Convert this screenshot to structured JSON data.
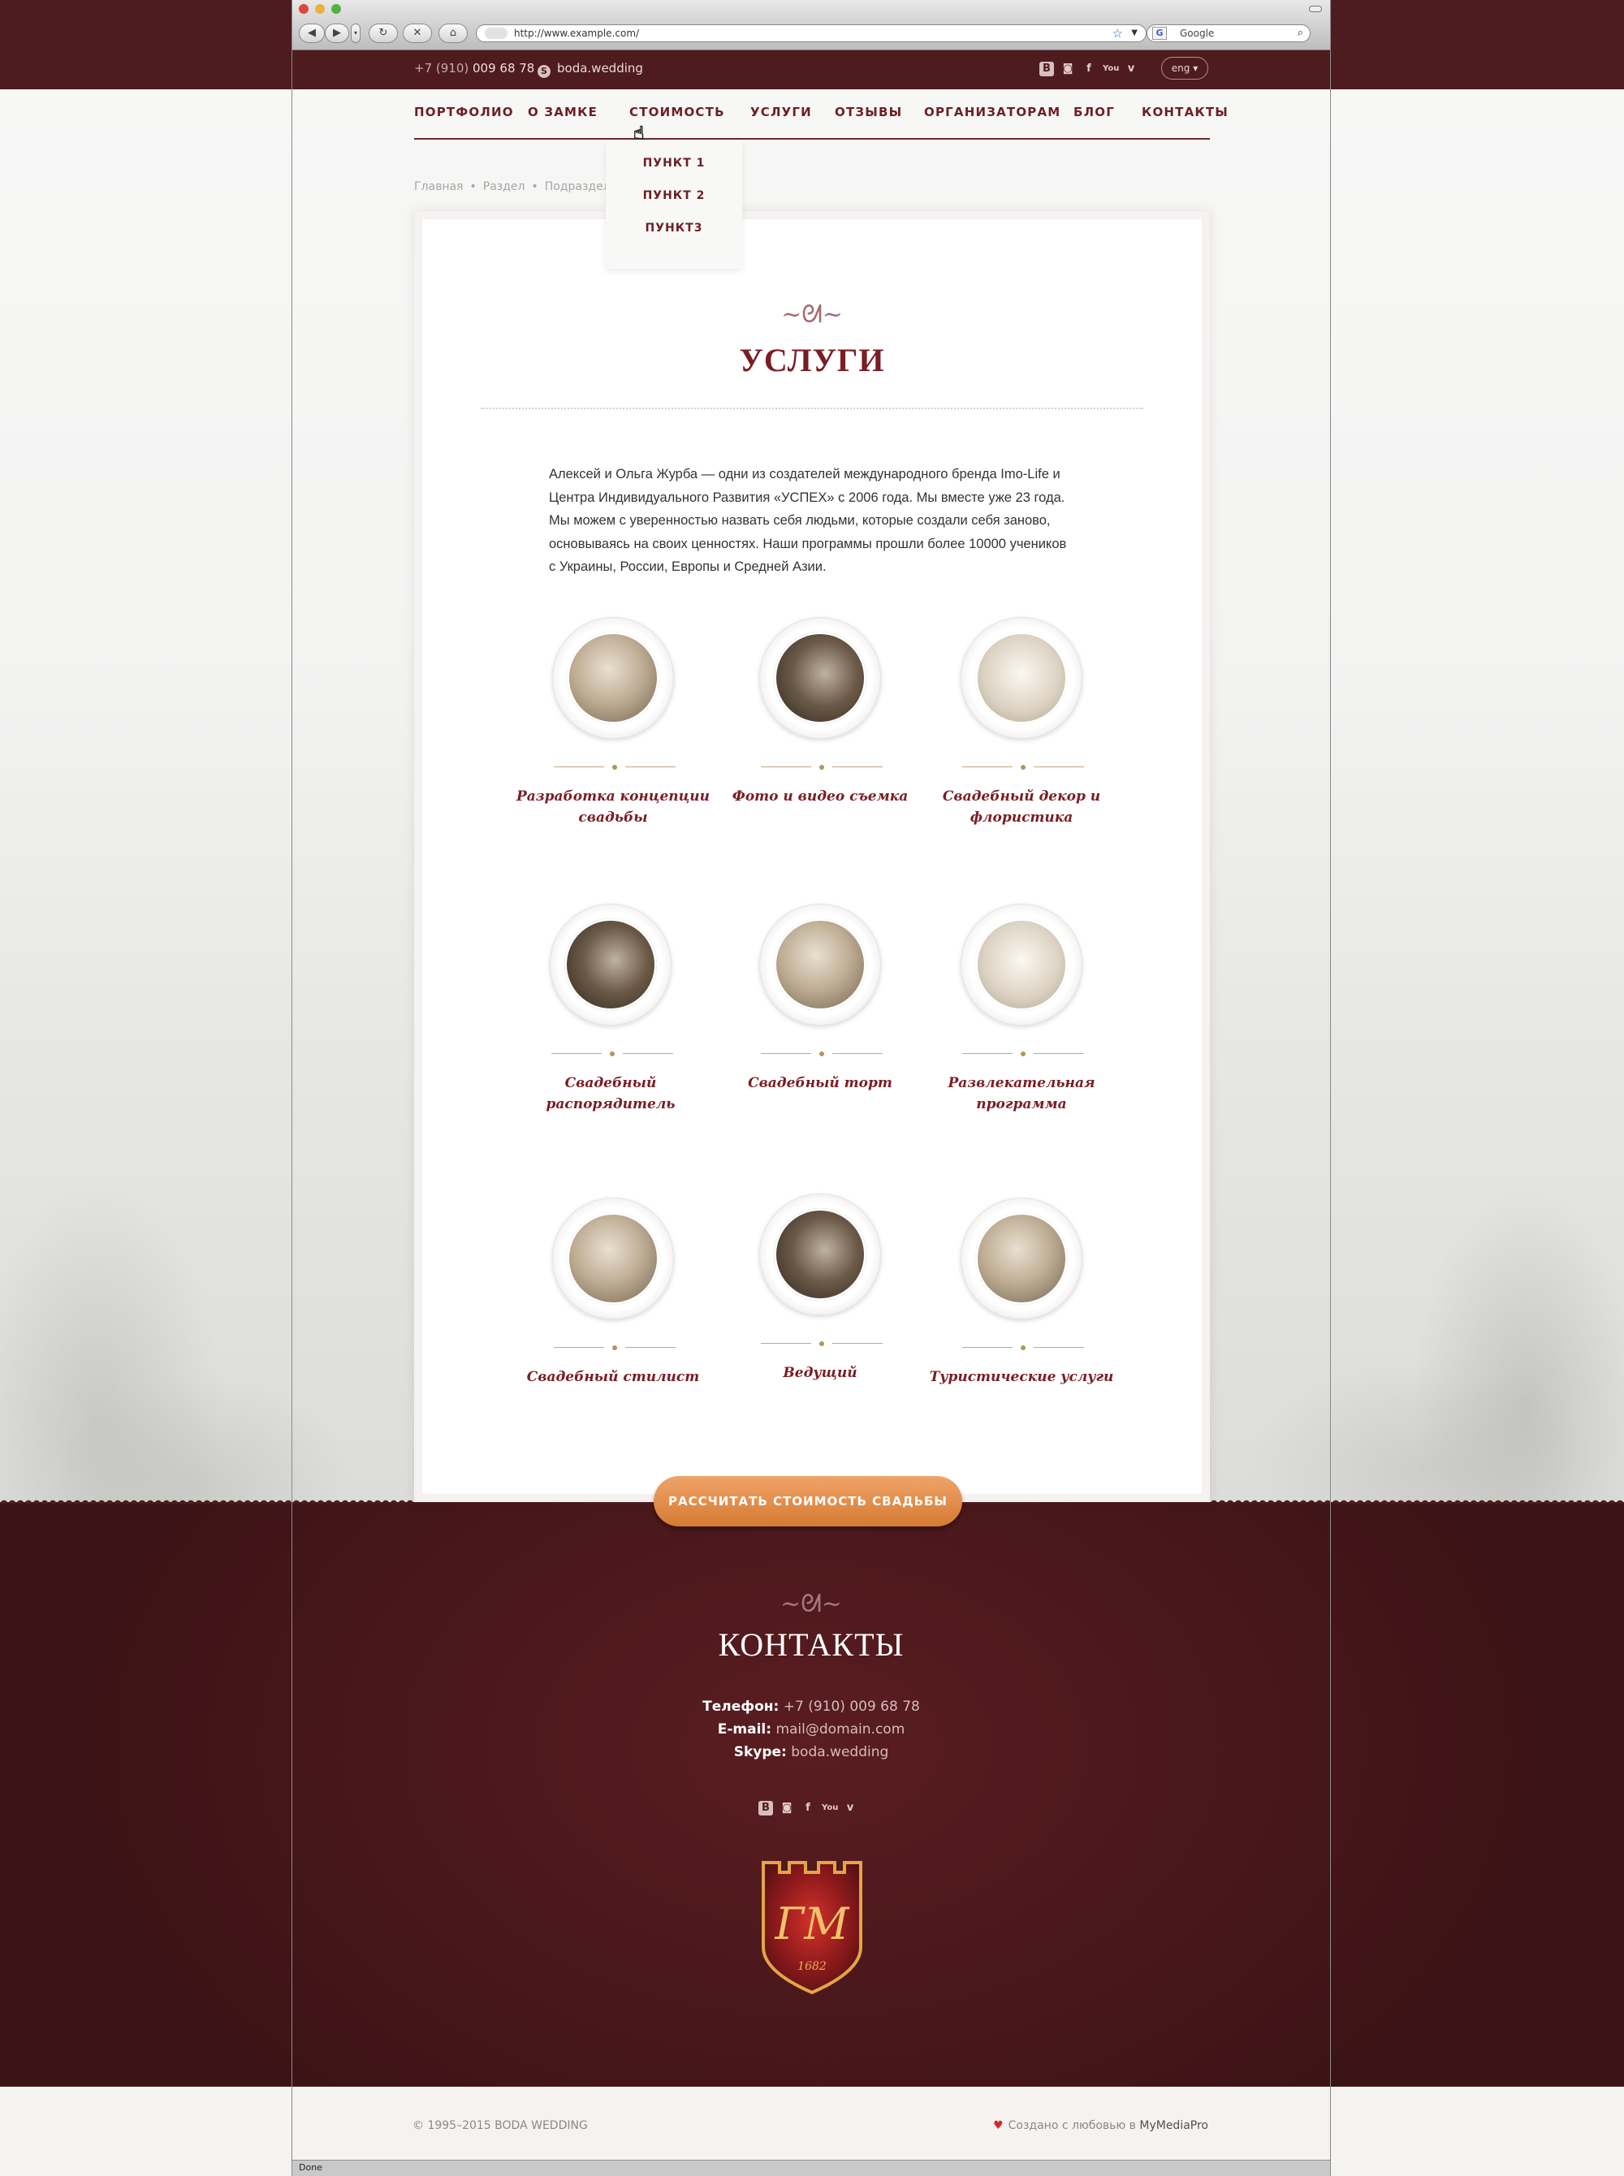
{
  "browser": {
    "url": "http://www.example.com/",
    "search_placeholder": "Google",
    "status": "Done"
  },
  "topbar": {
    "phone_prefix": "+7 (910)",
    "phone_number": "009 68 78",
    "skype": "boda.wedding",
    "lang": "eng",
    "socials": [
      "vk-icon",
      "instagram-icon",
      "facebook-icon",
      "youtube-icon",
      "vimeo-icon"
    ]
  },
  "nav": {
    "items": [
      "ПОРТФОЛИО",
      "О ЗАМКЕ",
      "СТОИМОСТЬ",
      "УСЛУГИ",
      "ОТЗЫВЫ",
      "ОРГАНИЗАТОРАМ",
      "БЛОГ",
      "КОНТАКТЫ"
    ],
    "dropdown": [
      "ПУНКТ 1",
      "ПУНКТ 2",
      "ПУНКТ3"
    ]
  },
  "breadcrumbs": [
    "Главная",
    "Раздел",
    "Подраздел"
  ],
  "page": {
    "title": "УСЛУГИ",
    "intro": "Алексей и Ольга Журба — одни из создателей международного бренда Imo-Life и Центра Индивидуального Развития «УСПЕХ» с 2006 года. Мы вместе уже 23 года. Мы можем с уверенностью назвать себя людьми, которые создали себя заново, основываясь на своих ценностях. Наши программы прошли более 10000 учеников с Украины, России, Европы и Средней Азии."
  },
  "services": [
    {
      "label": "Разработка концепции свадьбы"
    },
    {
      "label": "Фото и видео съемка"
    },
    {
      "label": "Свадебный декор и флористика"
    },
    {
      "label": "Свадебный распорядитель"
    },
    {
      "label": "Свадебный торт"
    },
    {
      "label": "Развлекательная программа"
    },
    {
      "label": "Свадебный стилист"
    },
    {
      "label": "Ведущий"
    },
    {
      "label": "Туристические услуги"
    }
  ],
  "cta": "РАССЧИТАТЬ СТОИМОСТЬ СВАДЬБЫ",
  "contacts": {
    "title": "КОНТАКТЫ",
    "phone_label": "Телефон:",
    "phone": "+7 (910) 009 68 78",
    "email_label": "E-mail:",
    "email": "mail@domain.com",
    "skype_label": "Skype:",
    "skype": "boda.wedding",
    "crest_monogram": "ГМ",
    "crest_year": "1682"
  },
  "footer": {
    "copyright": "© 1995–2015 BODA WEDDING",
    "made_prefix": "Создано с любовью в",
    "made_by": "MyMediaPro"
  },
  "colors": {
    "maroon": "#4e1b1e",
    "accent": "#7a1d24",
    "cta": "#e08a42"
  }
}
